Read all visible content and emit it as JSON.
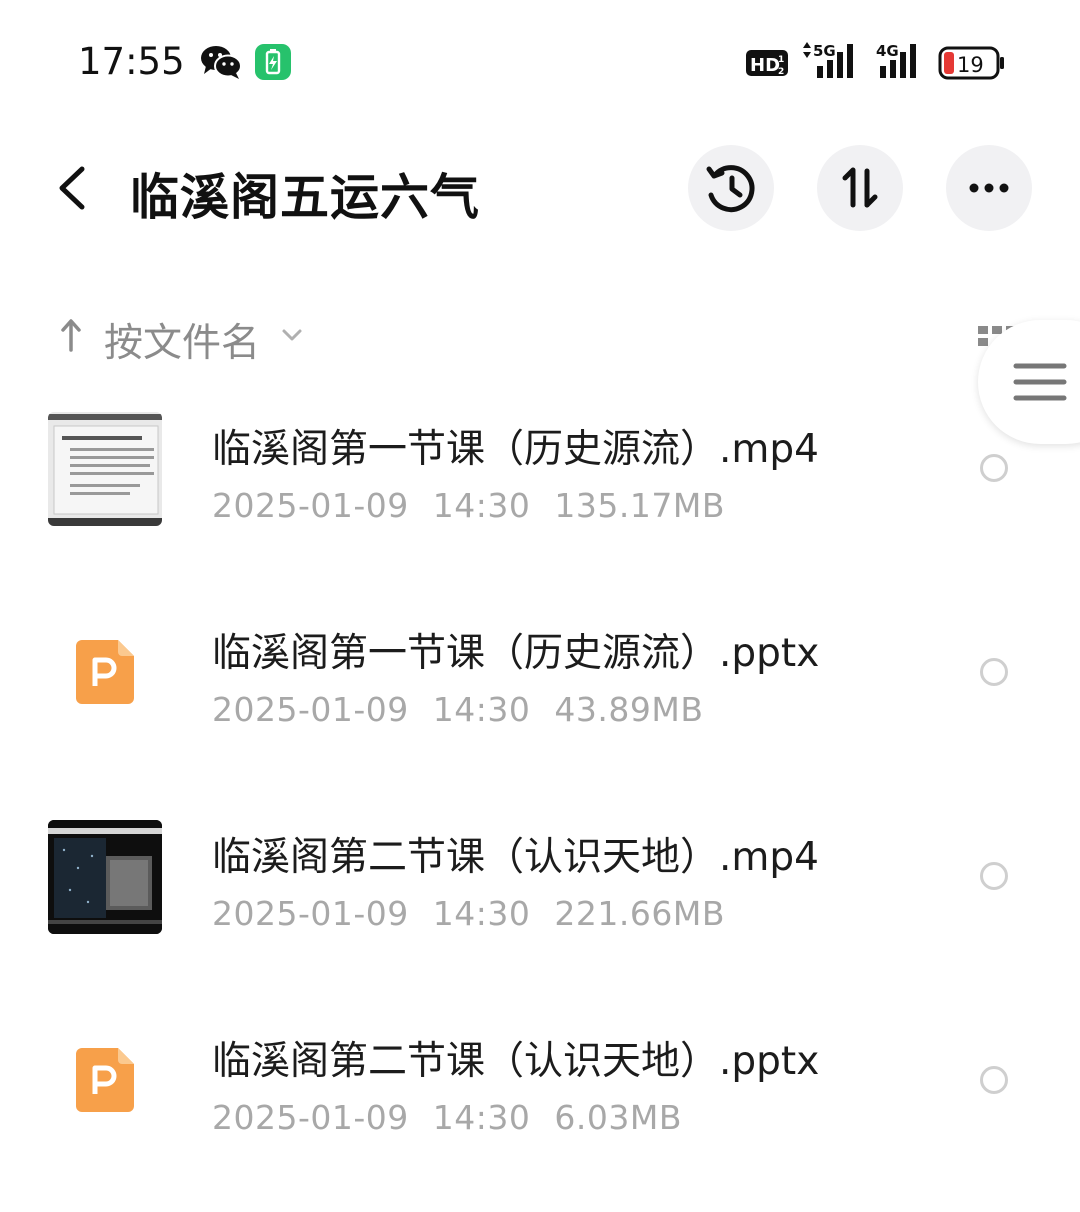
{
  "status_bar": {
    "time": "17:55",
    "battery_level": "19",
    "network_5g": "5G",
    "network_4g": "4G",
    "hd_label": "HD",
    "icons": [
      "wechat-icon",
      "battery-saver-icon",
      "hd-icon",
      "signal-5g-icon",
      "signal-4g-icon",
      "battery-icon"
    ]
  },
  "header": {
    "title": "临溪阁五运六气",
    "icons": [
      "back-icon",
      "history-icon",
      "sort-icon",
      "more-icon"
    ]
  },
  "sort": {
    "label": "按文件名"
  },
  "colors": {
    "ppt_orange": "#f7a04a",
    "battery_saver_green": "#27c26c",
    "battery_low_red": "#e53935",
    "meta_gray": "#a8a8a8"
  },
  "files": [
    {
      "name": "临溪阁第一节课（历史源流）.mp4",
      "date": "2025-01-09",
      "time": "14:30",
      "size": "135.17MB",
      "kind": "video-light"
    },
    {
      "name": "临溪阁第一节课（历史源流）.pptx",
      "date": "2025-01-09",
      "time": "14:30",
      "size": "43.89MB",
      "kind": "ppt"
    },
    {
      "name": "临溪阁第二节课（认识天地）.mp4",
      "date": "2025-01-09",
      "time": "14:30",
      "size": "221.66MB",
      "kind": "video-dark"
    },
    {
      "name": "临溪阁第二节课（认识天地）.pptx",
      "date": "2025-01-09",
      "time": "14:30",
      "size": "6.03MB",
      "kind": "ppt"
    }
  ]
}
